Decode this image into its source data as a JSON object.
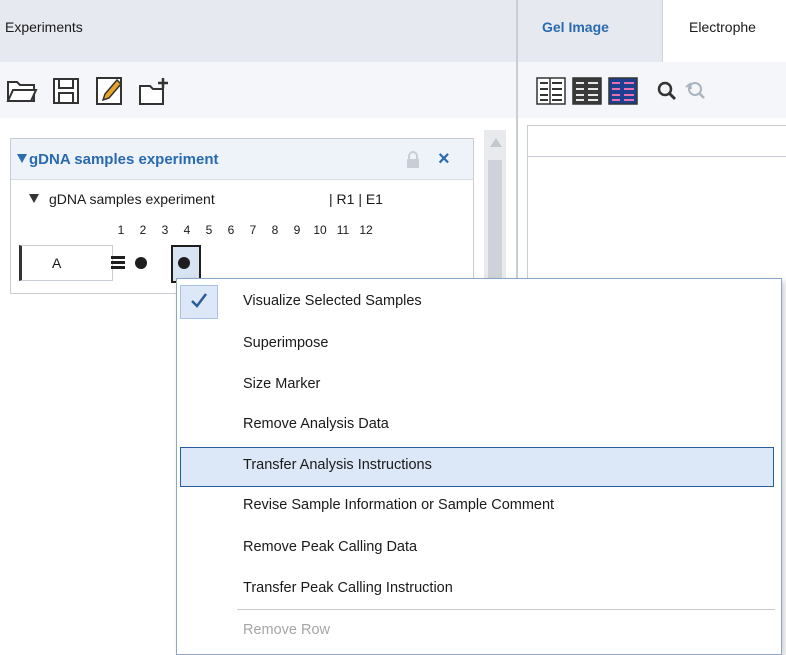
{
  "left_panel": {
    "title": "Experiments",
    "toolbar": {
      "open": "open-folder-icon",
      "save": "save-icon",
      "edit": "edit-icon",
      "new": "new-experiment-icon"
    },
    "experiment": {
      "title": "gDNA samples experiment",
      "sub_title": "gDNA samples experiment",
      "sub_tag": "| R1 | E1",
      "columns": [
        "1",
        "2",
        "3",
        "4",
        "5",
        "6",
        "7",
        "8",
        "9",
        "10",
        "11",
        "12"
      ],
      "row_label": "A"
    }
  },
  "right_panel": {
    "tabs": [
      {
        "label": "Gel Image"
      },
      {
        "label": "Electrophe"
      }
    ]
  },
  "context_menu": {
    "items": [
      {
        "label": "Visualize Selected Samples",
        "checked": true
      },
      {
        "label": "Superimpose"
      },
      {
        "label": "Size Marker"
      },
      {
        "label": "Remove Analysis Data"
      },
      {
        "label": "Transfer Analysis Instructions",
        "highlighted": true
      },
      {
        "label": "Revise Sample Information or Sample Comment"
      },
      {
        "label": "Remove Peak Calling Data"
      },
      {
        "label": "Transfer Peak Calling Instruction"
      },
      {
        "label": "Remove Row",
        "disabled": true
      }
    ]
  },
  "colors": {
    "accent": "#2a6ab0",
    "highlight_bg": "#dce7f7",
    "highlight_border": "#2a5c9a"
  }
}
